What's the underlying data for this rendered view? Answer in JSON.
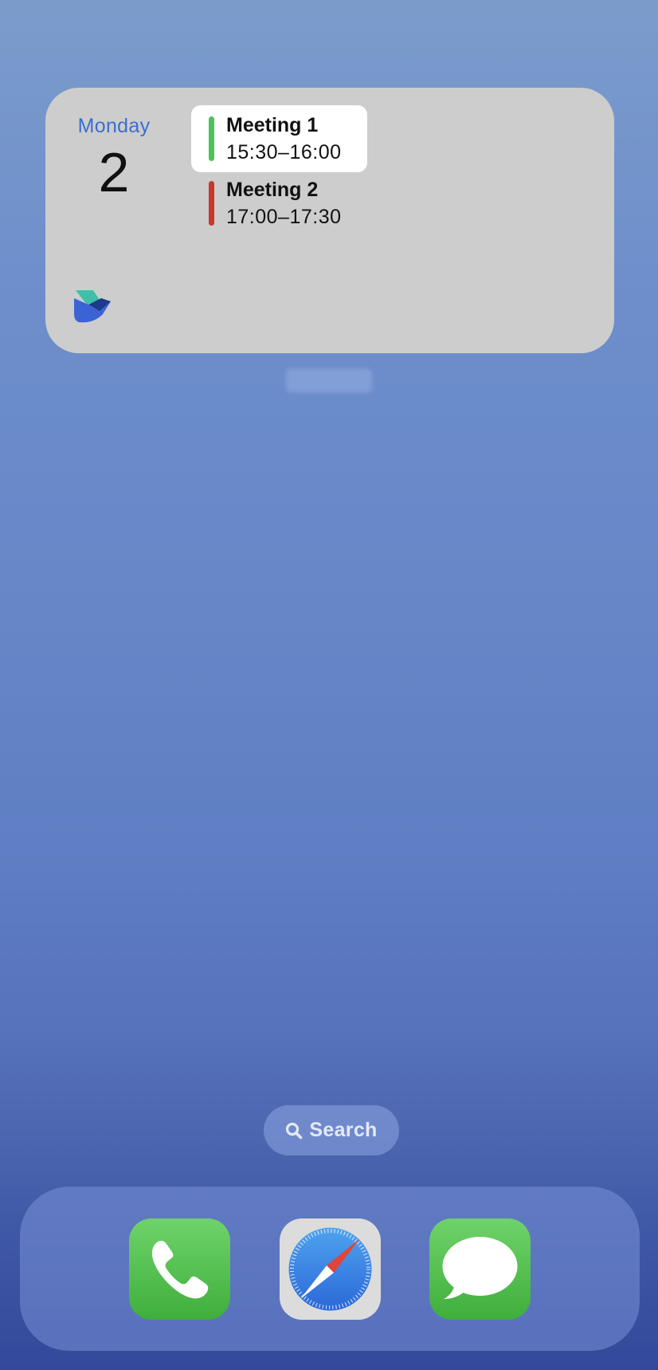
{
  "widget": {
    "day_name": "Monday",
    "day_number": "2",
    "logo_icon": "app-logo-icon",
    "events": [
      {
        "title": "Meeting 1",
        "time": "15:30–16:00",
        "color": "#4cc35a",
        "selected": true
      },
      {
        "title": "Meeting 2",
        "time": "17:00–17:30",
        "color": "#c8382c",
        "selected": false
      }
    ]
  },
  "search": {
    "label": "Search",
    "icon": "search-icon"
  },
  "dock": {
    "apps": [
      {
        "name": "Phone",
        "icon": "phone-icon"
      },
      {
        "name": "Safari",
        "icon": "compass-icon"
      },
      {
        "name": "Messages",
        "icon": "speech-bubble-icon"
      }
    ]
  },
  "colors": {
    "accent": "#3a6fd0",
    "widget_background": "#cdcdcd",
    "wallpaper_top": "#7b9ccb",
    "wallpaper_bottom": "#33489a"
  }
}
